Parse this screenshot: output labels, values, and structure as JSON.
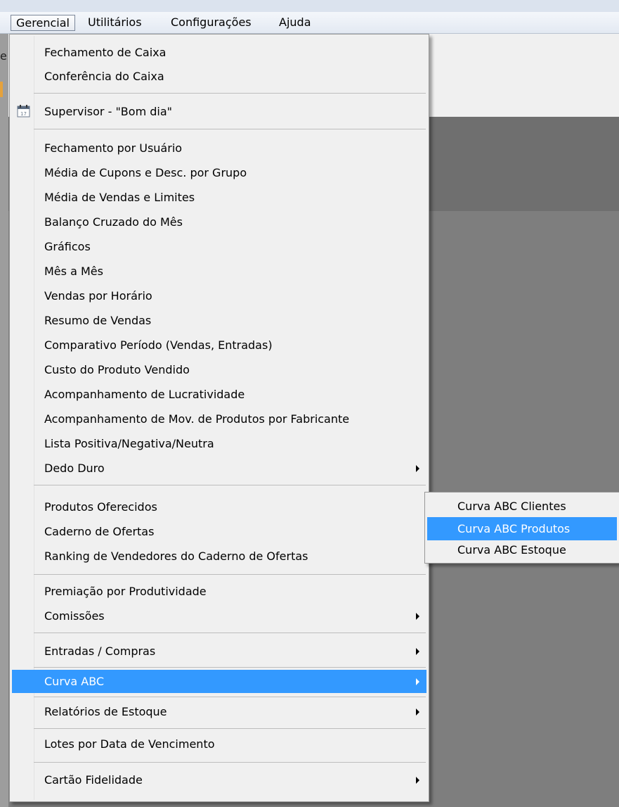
{
  "menubar": {
    "items": [
      "Gerencial",
      "Utilitários",
      "Configurações",
      "Ajuda"
    ],
    "active": "Gerencial"
  },
  "background": {
    "left_glyph": "e"
  },
  "menu": {
    "items": [
      {
        "label": "Fechamento de Caixa"
      },
      {
        "label": "Conferência do Caixa"
      },
      {
        "label": "Supervisor - \"Bom dia\"",
        "icon": "calendar-icon"
      },
      {
        "label": "Fechamento por Usuário"
      },
      {
        "label": "Média de Cupons e Desc. por Grupo"
      },
      {
        "label": "Média de Vendas e Limites"
      },
      {
        "label": "Balanço Cruzado do Mês"
      },
      {
        "label": "Gráficos"
      },
      {
        "label": "Mês a Mês"
      },
      {
        "label": "Vendas por Horário"
      },
      {
        "label": "Resumo de Vendas"
      },
      {
        "label": "Comparativo Período (Vendas, Entradas)"
      },
      {
        "label": "Custo do Produto Vendido"
      },
      {
        "label": "Acompanhamento de Lucratividade"
      },
      {
        "label": "Acompanhamento de Mov. de Produtos por Fabricante"
      },
      {
        "label": "Lista Positiva/Negativa/Neutra"
      },
      {
        "label": "Dedo Duro",
        "submenu": true
      },
      {
        "label": "Produtos Oferecidos"
      },
      {
        "label": "Caderno de Ofertas"
      },
      {
        "label": "Ranking de Vendedores do Caderno de Ofertas"
      },
      {
        "label": "Premiação por Produtividade"
      },
      {
        "label": "Comissões",
        "submenu": true
      },
      {
        "label": "Entradas / Compras",
        "submenu": true
      },
      {
        "label": "Curva ABC",
        "submenu": true,
        "highlighted": true
      },
      {
        "label": "Relatórios de Estoque",
        "submenu": true
      },
      {
        "label": "Lotes por Data de Vencimento"
      },
      {
        "label": "Cartão Fidelidade",
        "submenu": true
      }
    ],
    "calendar_icon_day": "17"
  },
  "submenu": {
    "items": [
      {
        "label": "Curva ABC Clientes"
      },
      {
        "label": "Curva ABC Produtos",
        "highlighted": true
      },
      {
        "label": "Curva ABC Estoque"
      }
    ]
  },
  "colors": {
    "highlight": "#3399ff",
    "menu_bg": "#f0f0f0",
    "menubar_bg": "#e3e9f2"
  }
}
